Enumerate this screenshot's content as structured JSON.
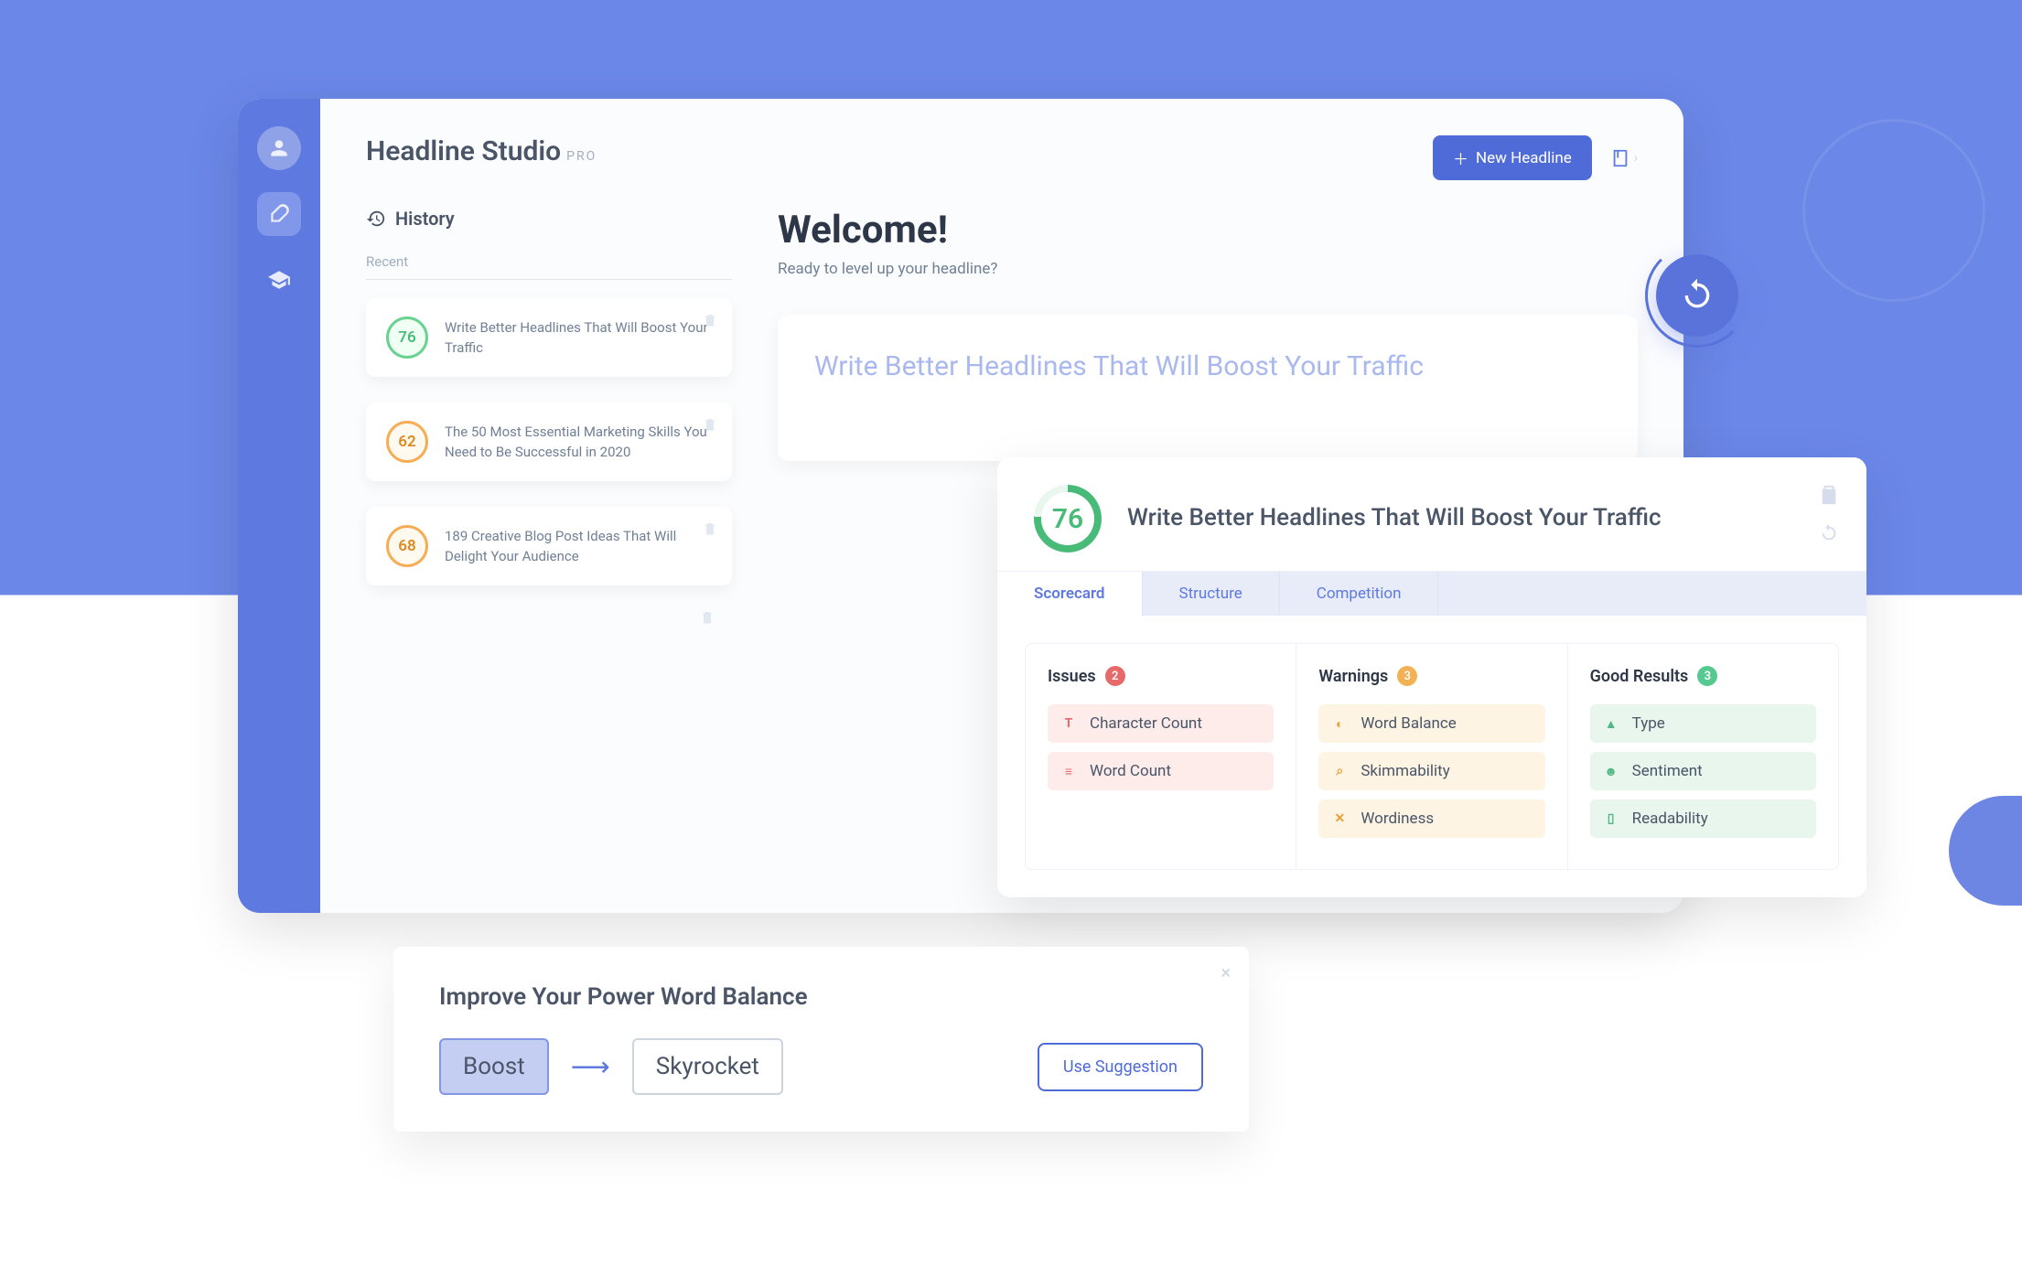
{
  "app": {
    "title": "Headline Studio",
    "badge": "PRO"
  },
  "actions": {
    "new_headline": "New Headline"
  },
  "history": {
    "title": "History",
    "recent_label": "Recent",
    "items": [
      {
        "score": "76",
        "color": "green",
        "text": "Write Better Headlines That Will Boost Your Traffic"
      },
      {
        "score": "62",
        "color": "orange",
        "text": "The 50 Most Essential Marketing Skills You Need to Be Successful in 2020"
      },
      {
        "score": "68",
        "color": "orange",
        "text": "189 Creative Blog Post Ideas That Will Delight Your Audience"
      }
    ]
  },
  "welcome": {
    "title": "Welcome!",
    "subtitle": "Ready to level up your headline?",
    "input_text": "Write Better Headlines That Will Boost Your Traffic"
  },
  "scorecard": {
    "score": "76",
    "headline": "Write Better Headlines That Will Boost Your Traffic",
    "tabs": [
      "Scorecard",
      "Structure",
      "Competition"
    ],
    "columns": {
      "issues": {
        "title": "Issues",
        "count": "2",
        "items": [
          "Character Count",
          "Word Count"
        ]
      },
      "warnings": {
        "title": "Warnings",
        "count": "3",
        "items": [
          "Word Balance",
          "Skimmability",
          "Wordiness"
        ]
      },
      "good": {
        "title": "Good Results",
        "count": "3",
        "items": [
          "Type",
          "Sentiment",
          "Readability"
        ]
      }
    }
  },
  "suggestion": {
    "title": "Improve Your Power Word Balance",
    "from": "Boost",
    "to": "Skyrocket",
    "button": "Use Suggestion"
  }
}
